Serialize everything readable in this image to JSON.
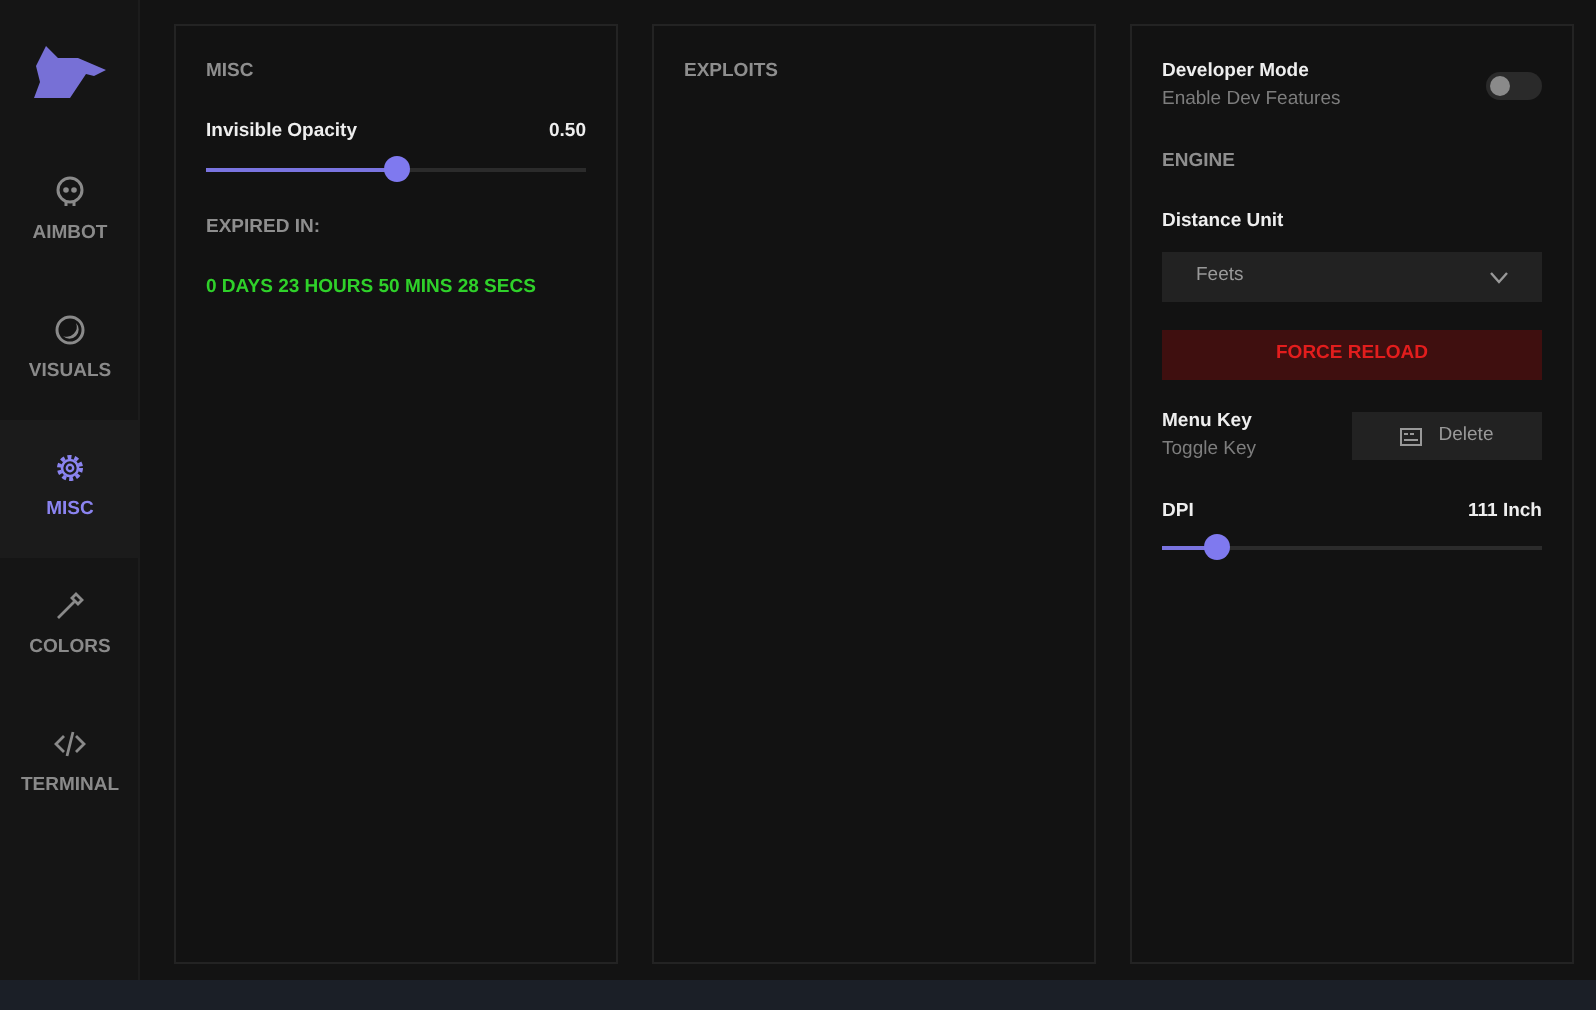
{
  "sidebar": {
    "items": [
      {
        "label": "AIMBOT",
        "selected": false
      },
      {
        "label": "VISUALS",
        "selected": false
      },
      {
        "label": "MISC",
        "selected": true
      },
      {
        "label": "COLORS",
        "selected": false
      },
      {
        "label": "TERMINAL",
        "selected": false
      }
    ]
  },
  "misc_panel": {
    "title": "MISC",
    "slider": {
      "label": "Invisible Opacity",
      "reading": "0.50",
      "level": 0.5
    },
    "expiry_label": "EXPIRED IN:",
    "expiry_value": "0 DAYS 23 HOURS 50 MINS 28 SECS"
  },
  "exploits_panel": {
    "title": "EXPLOITS"
  },
  "settings_panel": {
    "developer_mode": {
      "label": "Developer Mode",
      "sublabel": "Enable Dev Features",
      "on": false
    },
    "section": "ENGINE",
    "distance_unit": {
      "label": "Distance Unit",
      "value": "Feets"
    },
    "force_reload": "FORCE RELOAD",
    "menu_key": {
      "label": "Menu Key",
      "sublabel": "Toggle Key",
      "button": "Delete"
    },
    "dpi": {
      "label": "DPI",
      "reading": "111 Inch",
      "level": 0.14
    }
  }
}
